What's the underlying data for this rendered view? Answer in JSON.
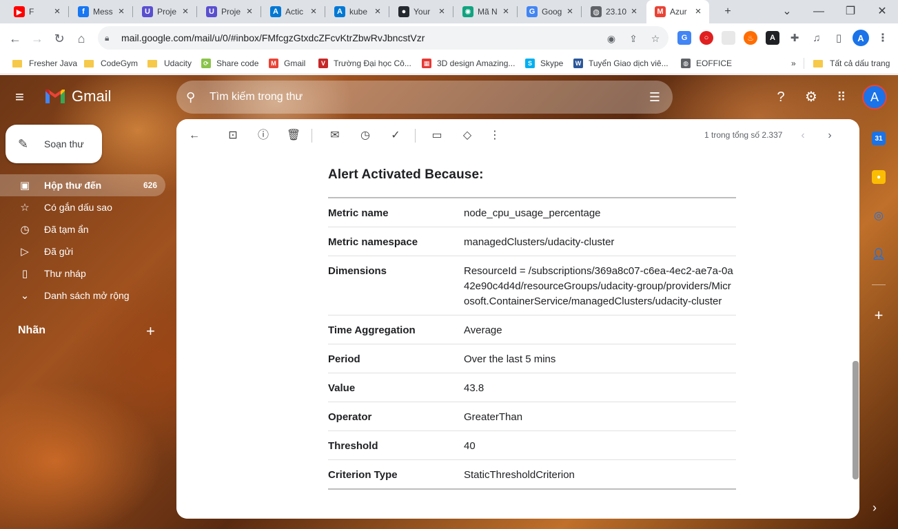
{
  "browser": {
    "tabs": [
      {
        "title": "F",
        "favicon": "youtube-icon",
        "color": "#ff0000",
        "glyph": "▶"
      },
      {
        "title": "Mess",
        "favicon": "facebook-icon",
        "color": "#1877f2",
        "glyph": "f"
      },
      {
        "title": "Proje",
        "favicon": "udacity-icon",
        "color": "#5a4fcf",
        "glyph": "U"
      },
      {
        "title": "Proje",
        "favicon": "udacity-icon",
        "color": "#5a4fcf",
        "glyph": "U"
      },
      {
        "title": "Actic",
        "favicon": "azure-icon",
        "color": "#0078d4",
        "glyph": "A"
      },
      {
        "title": "kube",
        "favicon": "azure-icon",
        "color": "#0078d4",
        "glyph": "A"
      },
      {
        "title": "Your",
        "favicon": "github-icon",
        "color": "#24292f",
        "glyph": "●"
      },
      {
        "title": "Mã N",
        "favicon": "chatgpt-icon",
        "color": "#10a37f",
        "glyph": "✺"
      },
      {
        "title": "Goog",
        "favicon": "google-translate-icon",
        "color": "#4285f4",
        "glyph": "G"
      },
      {
        "title": "23.10",
        "favicon": "globe-icon",
        "color": "#5f6368",
        "glyph": "◍"
      },
      {
        "title": "Azur",
        "favicon": "gmail-icon",
        "color": "#ea4335",
        "glyph": "M",
        "active": true
      }
    ],
    "url": "mail.google.com/mail/u/0/#inbox/FMfcgzGtxdcZFcvKtrZbwRvJbncstVzr",
    "bookmarks": [
      {
        "label": "Fresher Java",
        "icon": "folder-icon"
      },
      {
        "label": "CodeGym",
        "icon": "folder-icon"
      },
      {
        "label": "Udacity",
        "icon": "folder-icon"
      },
      {
        "label": "Share code",
        "icon": "share-code-icon"
      },
      {
        "label": "Gmail",
        "icon": "gmail-icon"
      },
      {
        "label": "Trường Đại học Cô...",
        "icon": "university-icon"
      },
      {
        "label": "3D design Amazing...",
        "icon": "tinkercad-icon"
      },
      {
        "label": "Skype",
        "icon": "skype-icon"
      },
      {
        "label": "Tuyển Giao dịch viê...",
        "icon": "word-icon"
      },
      {
        "label": "EOFFICE",
        "icon": "globe-icon"
      }
    ],
    "bookmarks_overflow": "»",
    "all_bookmarks": "Tất cả dấu trang"
  },
  "gmail": {
    "app_name": "Gmail",
    "search_placeholder": "Tìm kiếm trong thư",
    "compose_label": "Soạn thư",
    "nav": [
      {
        "label": "Hộp thư đến",
        "count": "626",
        "icon": "inbox-icon",
        "active": true
      },
      {
        "label": "Có gắn dấu sao",
        "count": "",
        "icon": "star-icon"
      },
      {
        "label": "Đã tạm ẩn",
        "count": "",
        "icon": "clock-icon"
      },
      {
        "label": "Đã gửi",
        "count": "",
        "icon": "send-icon"
      },
      {
        "label": "Thư nháp",
        "count": "",
        "icon": "draft-icon"
      },
      {
        "label": "Danh sách mở rộng",
        "count": "",
        "icon": "chevron-down-icon"
      }
    ],
    "labels_heading": "Nhãn",
    "avatar_letter": "A",
    "pager_text": "1 trong tổng số 2.337"
  },
  "email": {
    "heading": "Alert Activated Because:",
    "rows": [
      {
        "key": "Metric name",
        "value": "node_cpu_usage_percentage"
      },
      {
        "key": "Metric namespace",
        "value": "managedClusters/udacity-cluster"
      },
      {
        "key": "Dimensions",
        "value": "ResourceId = /subscriptions/369a8c07-c6ea-4ec2-ae7a-0a42e90c4d4d/resourceGroups/udacity-group/providers/Microsoft.ContainerService/managedClusters/udacity-cluster"
      },
      {
        "key": "Time Aggregation",
        "value": "Average"
      },
      {
        "key": "Period",
        "value": "Over the last 5 mins"
      },
      {
        "key": "Value",
        "value": "43.8"
      },
      {
        "key": "Operator",
        "value": "GreaterThan"
      },
      {
        "key": "Threshold",
        "value": "40"
      },
      {
        "key": "Criterion Type",
        "value": "StaticThresholdCriterion"
      }
    ]
  },
  "colors": {
    "gmail_red": "#ea4335",
    "chrome_tabstrip": "#dee1e6",
    "avatar_blue": "#1a73e8"
  }
}
